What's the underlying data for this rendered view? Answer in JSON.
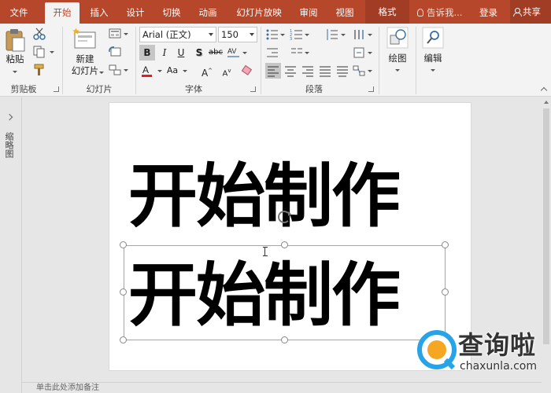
{
  "tabs": {
    "file": "文件",
    "home": "开始",
    "insert": "插入",
    "design": "设计",
    "transitions": "切换",
    "animations": "动画",
    "slideshow": "幻灯片放映",
    "review": "审阅",
    "view": "视图",
    "format": "格式",
    "tell_me": "告诉我...",
    "login": "登录",
    "share": "共享"
  },
  "ribbon": {
    "clipboard": {
      "paste_label": "粘贴",
      "group": "剪贴板"
    },
    "slides": {
      "new_slide_line1": "新建",
      "new_slide_line2": "幻灯片",
      "group": "幻灯片"
    },
    "font": {
      "font_name": "Arial (正文)",
      "font_size": "150",
      "group": "字体"
    },
    "paragraph": {
      "group": "段落"
    },
    "drawing": {
      "label": "绘图"
    },
    "editing": {
      "label": "编辑"
    },
    "accent_color": "#b7472a",
    "font_color_swatch": "#e02020"
  },
  "thumbnails": {
    "label": "缩略图"
  },
  "slide": {
    "line1": "开始制作",
    "line2": "开始制作"
  },
  "notes": {
    "placeholder": "单击此处添加备注"
  },
  "watermark": {
    "title": "查询啦",
    "url": "chaxunla.com"
  }
}
